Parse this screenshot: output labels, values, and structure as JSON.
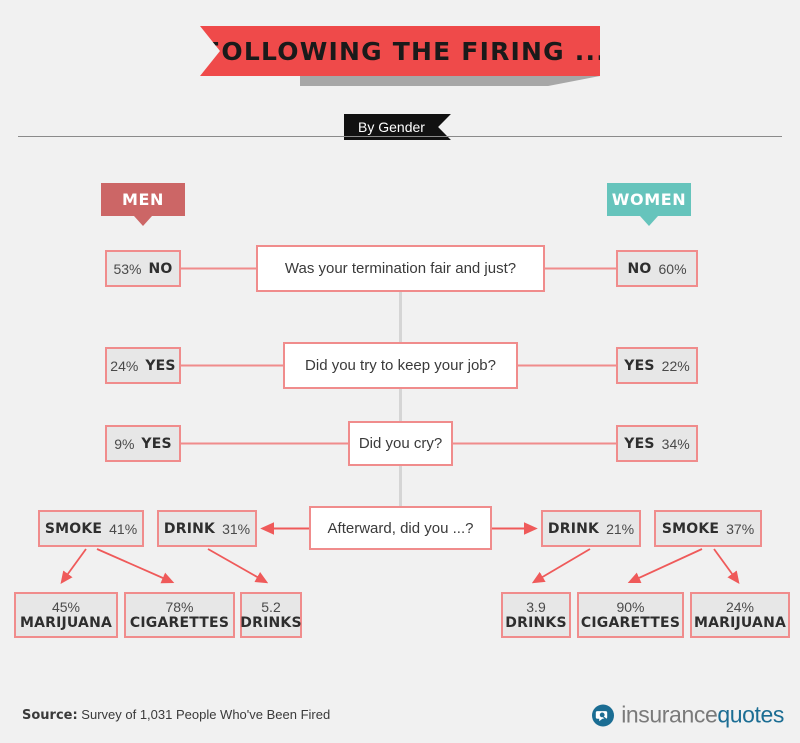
{
  "header": {
    "title": "FOLLOWING THE FIRING ...",
    "subtag": "By Gender"
  },
  "columns": {
    "men_label": "MEN",
    "women_label": "WOMEN",
    "men_color": "#cc6666",
    "women_color": "#66c4bc"
  },
  "accent_colors": {
    "ribbon_red": "#ef4a4a",
    "box_border": "#f08c8c",
    "arrow_red": "#ef5a5a",
    "box_fill": "#e7e7e7",
    "connector_gray": "#d5d5d5",
    "background": "#f1f1f1"
  },
  "rows": [
    {
      "question": "Was your termination fair and just?",
      "men": {
        "pct": "53%",
        "label": "NO"
      },
      "women": {
        "label": "NO",
        "pct": "60%"
      }
    },
    {
      "question": "Did you try to keep your job?",
      "men": {
        "pct": "24%",
        "label": "YES"
      },
      "women": {
        "label": "YES",
        "pct": "22%"
      }
    },
    {
      "question": "Did you cry?",
      "men": {
        "pct": "9%",
        "label": "YES"
      },
      "women": {
        "label": "YES",
        "pct": "34%"
      }
    }
  ],
  "afterward": {
    "question": "Afterward, did you ...?",
    "men": {
      "habits": [
        {
          "label": "SMOKE",
          "pct": "41%"
        },
        {
          "label": "DRINK",
          "pct": "31%"
        }
      ],
      "results": [
        {
          "value": "45%",
          "label": "MARIJUANA"
        },
        {
          "value": "78%",
          "label": "CIGARETTES"
        },
        {
          "value": "5.2",
          "label": "DRINKS"
        }
      ]
    },
    "women": {
      "habits": [
        {
          "label": "DRINK",
          "pct": "21%"
        },
        {
          "label": "SMOKE",
          "pct": "37%"
        }
      ],
      "results": [
        {
          "value": "3.9",
          "label": "DRINKS"
        },
        {
          "value": "90%",
          "label": "CIGARETTES"
        },
        {
          "value": "24%",
          "label": "MARIJUANA"
        }
      ]
    }
  },
  "footer": {
    "source_label": "Source:",
    "source_text": " Survey of 1,031 People Who've Been Fired",
    "logo_part1": "insurance",
    "logo_part2": "quotes"
  }
}
